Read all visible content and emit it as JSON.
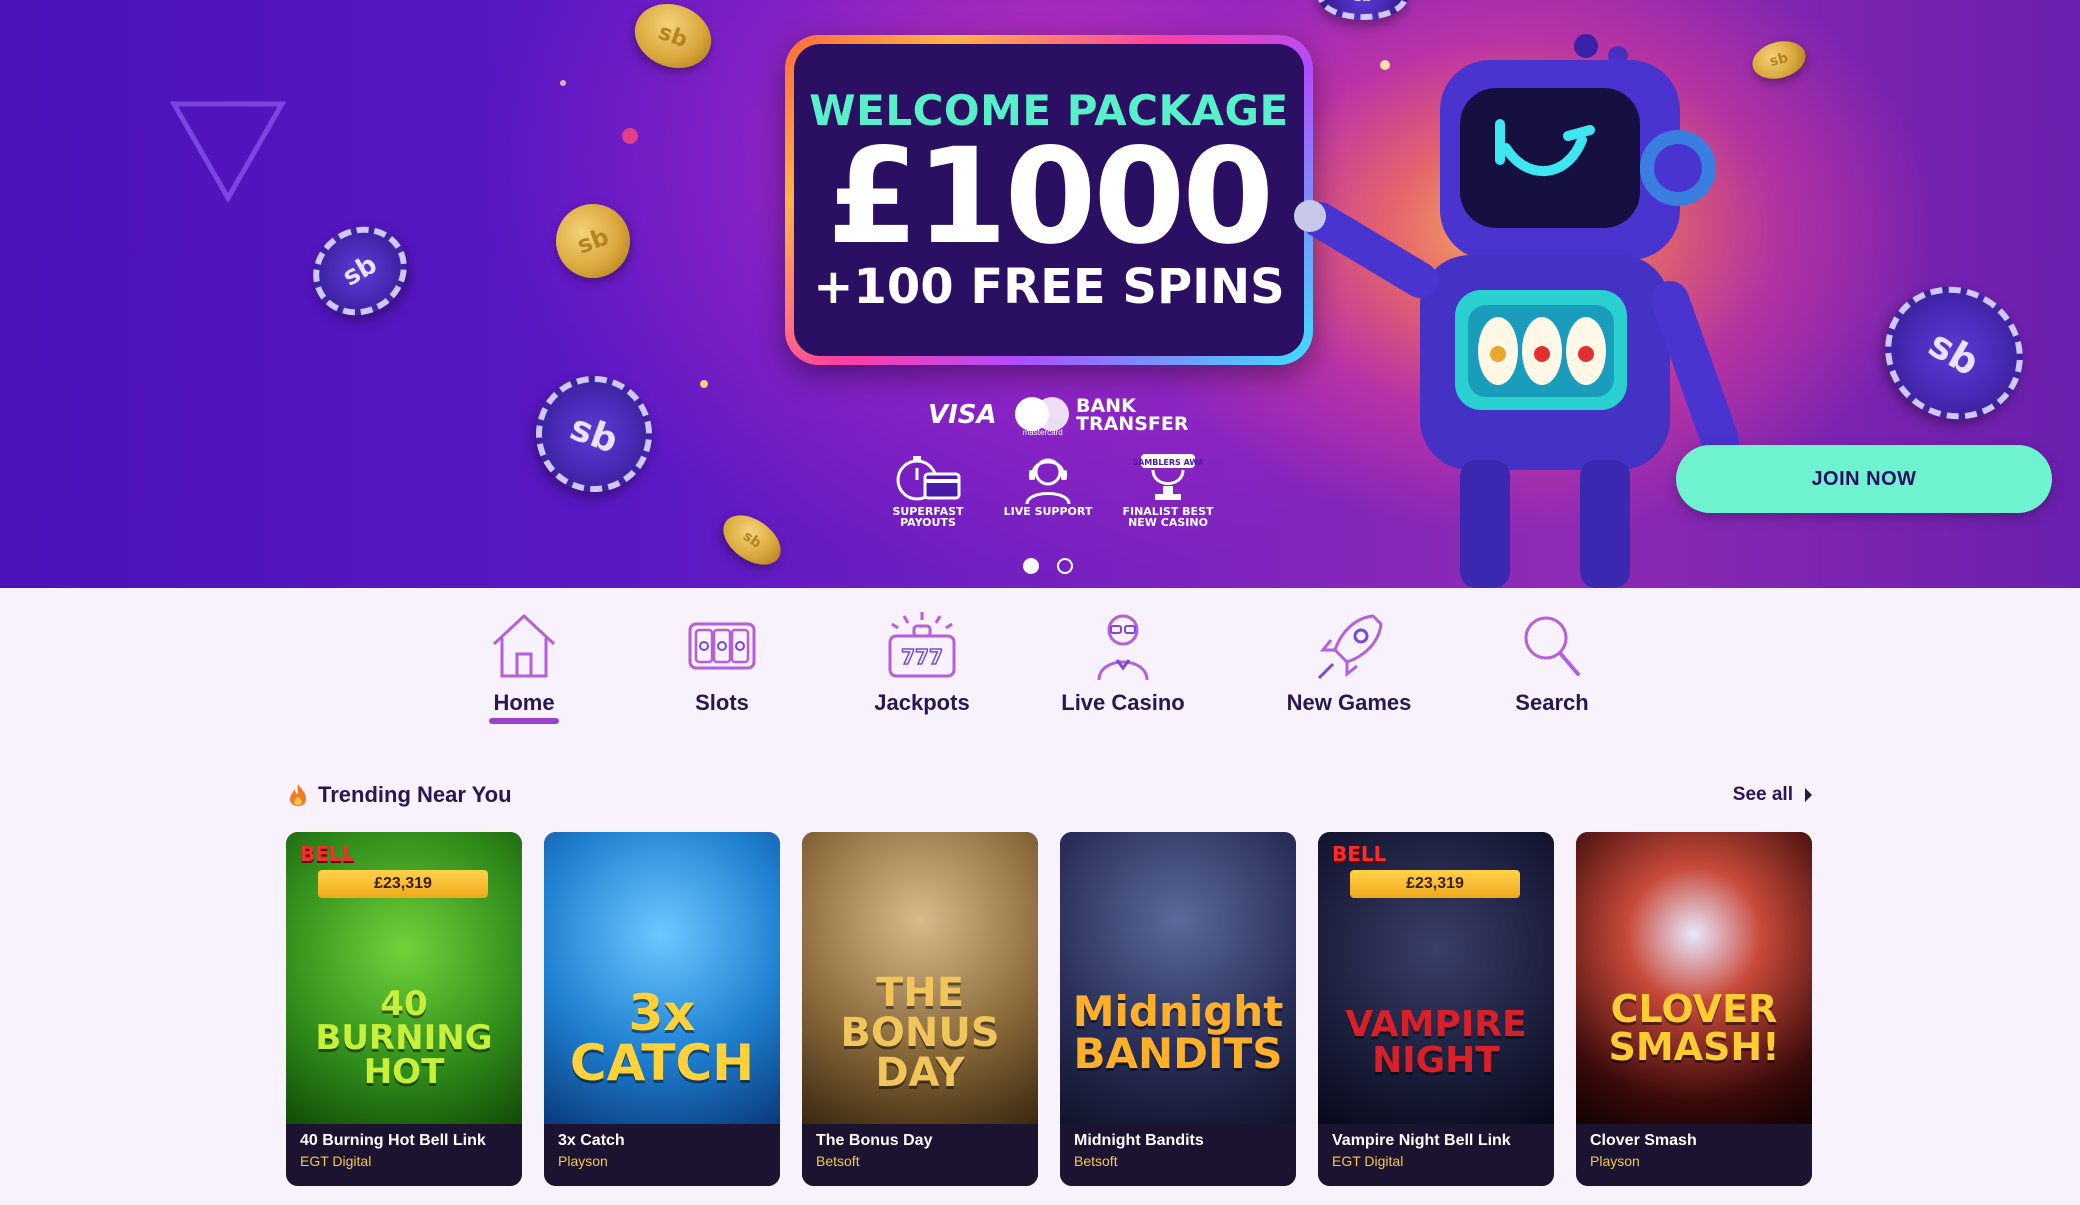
{
  "hero": {
    "promo_line1": "WELCOME PACKAGE",
    "promo_amount": "£1000",
    "promo_line3": "+100 FREE SPINS",
    "payments": {
      "visa": "VISA",
      "mastercard": "mastercard",
      "bank": "BANK TRANSFER"
    },
    "badges": [
      {
        "label": "SUPERFAST PAYOUTS",
        "icon": "stopwatch-card-icon"
      },
      {
        "label": "LIVE SUPPORT",
        "icon": "headset-agent-icon"
      },
      {
        "label": "FINALIST BEST NEW CASINO",
        "icon": "askgamblers-award-icon",
        "award_text": "ASKGAMBLERS AWARDS"
      }
    ],
    "coin_text": "sb",
    "chip_text": "sb",
    "join_label": "JOIN NOW",
    "slides": 2,
    "active_slide": 1
  },
  "nav": {
    "items": [
      {
        "label": "Home",
        "icon": "house-icon",
        "active": true
      },
      {
        "label": "Slots",
        "icon": "slot-reels-icon",
        "active": false
      },
      {
        "label": "Jackpots",
        "icon": "jackpot-777-icon",
        "active": false
      },
      {
        "label": "Live Casino",
        "icon": "dealer-icon",
        "active": false
      },
      {
        "label": "New Games",
        "icon": "rocket-icon",
        "active": false
      },
      {
        "label": "Search",
        "icon": "magnifier-icon",
        "active": false
      }
    ]
  },
  "trending": {
    "title": "Trending Near You",
    "see_all": "See all",
    "games": [
      {
        "name": "40 Burning Hot Bell Link",
        "provider": "EGT Digital",
        "art_text": "40 BURNING HOT",
        "jackpot": "£23,319",
        "bell": "BELL",
        "bg": "#2f8a1a",
        "accent": "#c6f03a"
      },
      {
        "name": "3x Catch",
        "provider": "Playson",
        "art_text": "3x CATCH",
        "jackpot": null,
        "bell": null,
        "bg": "#1f7fd0",
        "accent": "#ffd23a"
      },
      {
        "name": "The Bonus Day",
        "provider": "Betsoft",
        "art_text": "THE BONUS DAY",
        "jackpot": null,
        "bell": null,
        "bg": "#8a6a3a",
        "accent": "#f2c55a"
      },
      {
        "name": "Midnight Bandits",
        "provider": "Betsoft",
        "art_text": "Midnight BANDITS",
        "jackpot": null,
        "bell": null,
        "bg": "#2a2f5a",
        "accent": "#ffb02a"
      },
      {
        "name": "Vampire Night Bell Link",
        "provider": "EGT Digital",
        "art_text": "VAMPIRE NIGHT",
        "jackpot": "£23,319",
        "bell": "BELL",
        "bg": "#1a1d3a",
        "accent": "#d8202a"
      },
      {
        "name": "Clover Smash",
        "provider": "Playson",
        "art_text": "CLOVER SMASH!",
        "jackpot": null,
        "bell": null,
        "bg": "#3a0a0a",
        "accent": "#ffcc33"
      }
    ]
  }
}
